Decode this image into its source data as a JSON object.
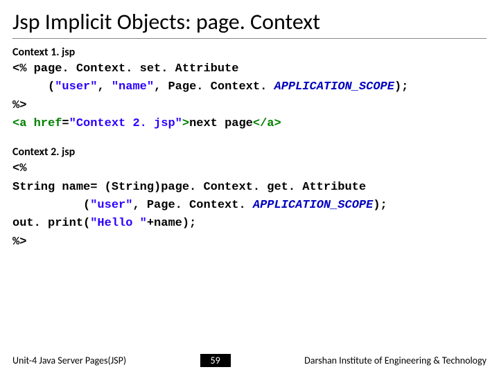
{
  "title": "Jsp Implicit Objects:  page. Context",
  "block1": {
    "heading": "Context 1. jsp",
    "l1a": "<% page. Context. set. Attribute",
    "l2a": "     (",
    "l2b": "\"user\"",
    "l2c": ", ",
    "l2d": "\"name\"",
    "l2e": ", Page. Context. ",
    "l2f": "APPLICATION_SCOPE",
    "l2g": ");",
    "l3a": "%>",
    "l4a": "<a ",
    "l4b": "href",
    "l4c": "=",
    "l4d": "\"Context 2. jsp\"",
    "l4e": ">",
    "l4f": "next page",
    "l4g": "</a>"
  },
  "block2": {
    "heading": "Context 2. jsp",
    "l1": "<%",
    "l2": "String name= (String)page. Context. get. Attribute",
    "l3a": "          (",
    "l3b": "\"user\"",
    "l3c": ", Page. Context. ",
    "l3d": "APPLICATION_SCOPE",
    "l3e": ");",
    "l4a": "out. print(",
    "l4b": "\"Hello \"",
    "l4c": "+name);",
    "l5": "%>"
  },
  "footer": {
    "left": "Unit-4 Java Server Pages(JSP)",
    "page": "59",
    "right": "Darshan Institute of Engineering & Technology"
  }
}
